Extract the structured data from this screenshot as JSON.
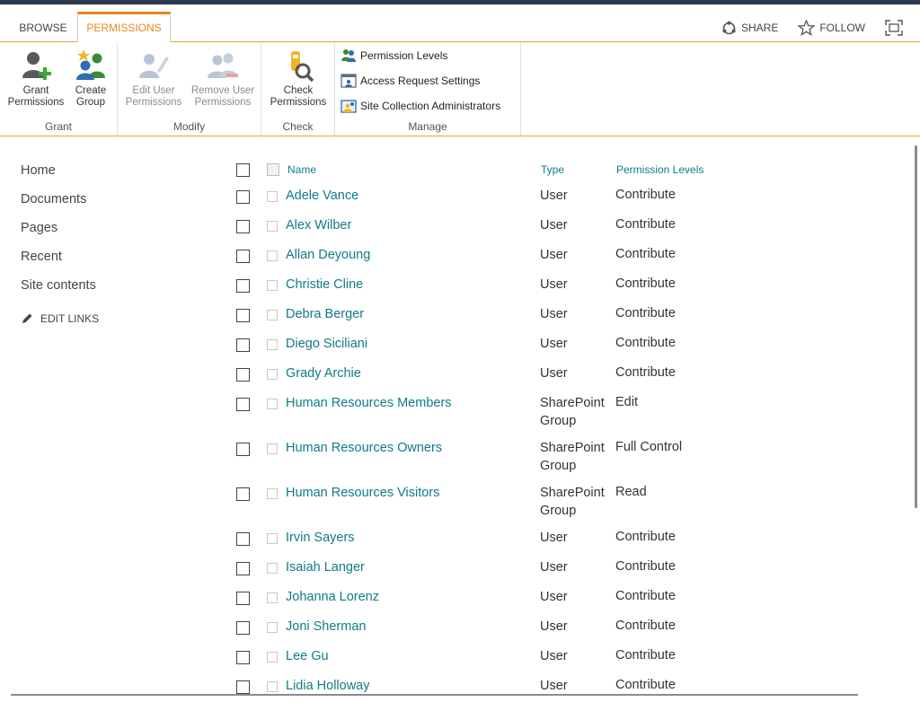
{
  "ribbon_tabs": {
    "browse": "BROWSE",
    "permissions": "PERMISSIONS"
  },
  "tab_actions": {
    "share": "SHARE",
    "follow": "FOLLOW"
  },
  "groups": {
    "grant": {
      "label": "Grant",
      "grant_permissions": [
        "Grant",
        "Permissions"
      ],
      "create_group": [
        "Create",
        "Group"
      ]
    },
    "modify": {
      "label": "Modify",
      "edit_user_permissions": [
        "Edit User",
        "Permissions"
      ],
      "remove_user_permissions": [
        "Remove User",
        "Permissions"
      ]
    },
    "check": {
      "label": "Check",
      "check_permissions": [
        "Check",
        "Permissions"
      ]
    },
    "manage": {
      "label": "Manage",
      "permission_levels": "Permission Levels",
      "access_request_settings": "Access Request Settings",
      "site_collection_administrators": "Site Collection Administrators"
    }
  },
  "nav": {
    "items": [
      "Home",
      "Documents",
      "Pages",
      "Recent",
      "Site contents"
    ],
    "edit_links": "EDIT LINKS"
  },
  "table": {
    "headers": {
      "name": "Name",
      "type": "Type",
      "permission_levels": "Permission Levels"
    },
    "rows": [
      {
        "name": "Adele Vance",
        "type": [
          "User"
        ],
        "level": "Contribute"
      },
      {
        "name": "Alex Wilber",
        "type": [
          "User"
        ],
        "level": "Contribute"
      },
      {
        "name": "Allan Deyoung",
        "type": [
          "User"
        ],
        "level": "Contribute"
      },
      {
        "name": "Christie Cline",
        "type": [
          "User"
        ],
        "level": "Contribute"
      },
      {
        "name": "Debra Berger",
        "type": [
          "User"
        ],
        "level": "Contribute"
      },
      {
        "name": "Diego Siciliani",
        "type": [
          "User"
        ],
        "level": "Contribute"
      },
      {
        "name": "Grady Archie",
        "type": [
          "User"
        ],
        "level": "Contribute"
      },
      {
        "name": "Human Resources Members",
        "type": [
          "SharePoint",
          "Group"
        ],
        "level": "Edit"
      },
      {
        "name": "Human Resources Owners",
        "type": [
          "SharePoint",
          "Group"
        ],
        "level": "Full Control"
      },
      {
        "name": "Human Resources Visitors",
        "type": [
          "SharePoint",
          "Group"
        ],
        "level": "Read"
      },
      {
        "name": "Irvin Sayers",
        "type": [
          "User"
        ],
        "level": "Contribute"
      },
      {
        "name": "Isaiah Langer",
        "type": [
          "User"
        ],
        "level": "Contribute"
      },
      {
        "name": "Johanna Lorenz",
        "type": [
          "User"
        ],
        "level": "Contribute"
      },
      {
        "name": "Joni Sherman",
        "type": [
          "User"
        ],
        "level": "Contribute"
      },
      {
        "name": "Lee Gu",
        "type": [
          "User"
        ],
        "level": "Contribute"
      },
      {
        "name": "Lidia Holloway",
        "type": [
          "User"
        ],
        "level": "Contribute"
      }
    ]
  },
  "colors": {
    "accent": "#e8871e",
    "link": "#0f7b88",
    "border": "#f0a030"
  }
}
